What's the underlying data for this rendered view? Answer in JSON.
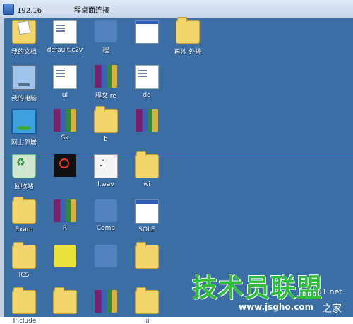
{
  "window": {
    "title_prefix": "192.16",
    "title_suffix": "程桌面连接"
  },
  "desktop": {
    "background_color": "#3a6ea5",
    "icons": [
      {
        "name": "my-documents-icon",
        "label": "我的文档"
      },
      {
        "name": "default-rdp-file-icon",
        "label": "default.c2v"
      },
      {
        "name": "remote-program-icon",
        "label": "程"
      },
      {
        "name": "window-shortcut-icon",
        "label": ""
      },
      {
        "name": "folder-icon",
        "label": "再沙  外挑"
      },
      {
        "name": "my-computer-icon",
        "label": "我的电脑"
      },
      {
        "name": "document-file-icon",
        "label": "ul"
      },
      {
        "name": "archive-file-icon",
        "label": "程文 re"
      },
      {
        "name": "doc-file-icon",
        "label": "do"
      },
      {
        "name": "network-places-icon",
        "label": "网上邻居"
      },
      {
        "name": "archive-file-icon",
        "label": "Sk"
      },
      {
        "name": "folder-icon",
        "label": "b"
      },
      {
        "name": "archive-file-icon",
        "label": ""
      },
      {
        "name": "recycle-bin-icon",
        "label": "回收站"
      },
      {
        "name": "image-file-icon",
        "label": ""
      },
      {
        "name": "wav-file-icon",
        "label": "l.wav"
      },
      {
        "name": "folder-icon",
        "label": "wi"
      },
      {
        "name": "folder-icon",
        "label": "Exam"
      },
      {
        "name": "archive-file-icon",
        "label": "R"
      },
      {
        "name": "blurred-icon",
        "label": "Comp"
      },
      {
        "name": "window-shortcut-icon",
        "label": "SOLE"
      },
      {
        "name": "folder-icon",
        "label": "ICS"
      },
      {
        "name": "highlighted-icon",
        "label": ""
      },
      {
        "name": "blurred-icon",
        "label": ""
      },
      {
        "name": "folder-icon",
        "label": ""
      },
      {
        "name": "folder-icon",
        "label": "Include"
      },
      {
        "name": "folder-icon",
        "label": ""
      },
      {
        "name": "archive-file-icon",
        "label": ""
      },
      {
        "name": "folder-icon",
        "label": "ii"
      }
    ]
  },
  "watermark": {
    "brand": "技术员联盟",
    "url": "www.jsgho.com",
    "url2": "j51.net",
    "tag": "之家"
  },
  "colors": {
    "desktop": "#3a6ea5",
    "divider_line": "#c0262e",
    "watermark_green": "#2fbe3c"
  }
}
